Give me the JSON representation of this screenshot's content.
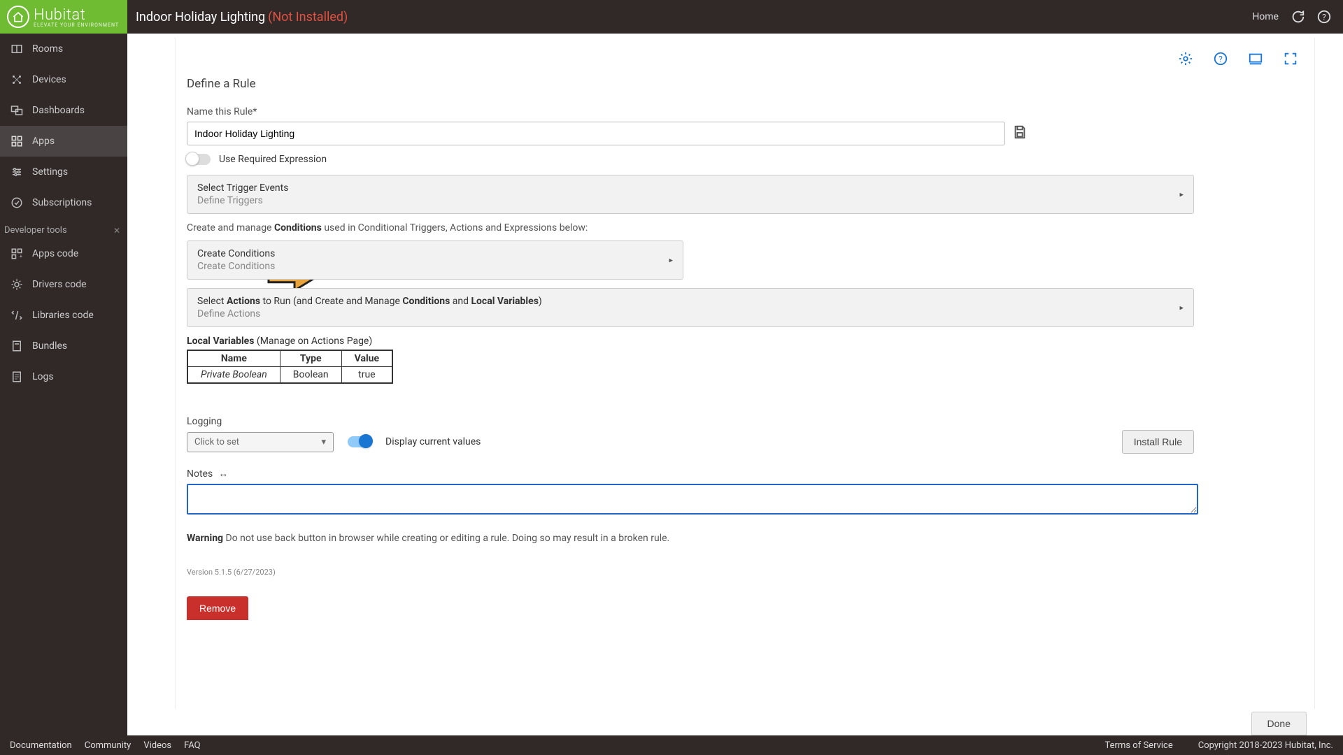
{
  "brand": {
    "name": "Hubitat",
    "tagline": "ELEVATE YOUR ENVIRONMENT"
  },
  "header": {
    "title": "Indoor Holiday Lighting",
    "status": "(Not Installed)",
    "home": "Home"
  },
  "sidebar": {
    "items": [
      {
        "id": "rooms",
        "label": "Rooms"
      },
      {
        "id": "devices",
        "label": "Devices"
      },
      {
        "id": "dashboards",
        "label": "Dashboards"
      },
      {
        "id": "apps",
        "label": "Apps",
        "active": true
      },
      {
        "id": "settings",
        "label": "Settings"
      },
      {
        "id": "subscriptions",
        "label": "Subscriptions"
      }
    ],
    "dev_section": "Developer tools",
    "dev_items": [
      {
        "id": "apps-code",
        "label": "Apps code"
      },
      {
        "id": "drivers-code",
        "label": "Drivers code"
      },
      {
        "id": "libraries-code",
        "label": "Libraries code"
      },
      {
        "id": "bundles",
        "label": "Bundles"
      },
      {
        "id": "logs",
        "label": "Logs"
      }
    ]
  },
  "page": {
    "section_title": "Define a Rule",
    "name_label": "Name this Rule*",
    "name_value": "Indoor Holiday Lighting",
    "use_required_expression": "Use Required Expression",
    "trigger_panel": {
      "title": "Select Trigger Events",
      "subtitle": "Define Triggers"
    },
    "conditions_intro_pre": "Create and manage ",
    "conditions_intro_bold": "Conditions",
    "conditions_intro_post": " used in Conditional Triggers, Actions and Expressions below:",
    "conditions_panel": {
      "title": "Create Conditions",
      "subtitle": "Create Conditions"
    },
    "actions_panel": {
      "pre": "Select ",
      "b1": "Actions",
      "mid1": " to Run (and Create and Manage ",
      "b2": "Conditions",
      "mid2": " and ",
      "b3": "Local Variables",
      "post": ")",
      "subtitle": "Define Actions"
    },
    "local_vars_title_bold": "Local Variables",
    "local_vars_title_rest": " (Manage on Actions Page)",
    "lv_headers": {
      "name": "Name",
      "type": "Type",
      "value": "Value"
    },
    "lv_row": {
      "name": "Private Boolean",
      "type": "Boolean",
      "value": "true"
    },
    "logging_label": "Logging",
    "logging_dropdown": "Click to set",
    "display_current": "Display current values",
    "install_rule": "Install Rule",
    "notes_label": "Notes",
    "warning_bold": "Warning",
    "warning_text": " Do not use back button in browser while creating or editing a rule. Doing so may result in a broken rule.",
    "version": "Version 5.1.5 (6/27/2023)",
    "remove": "Remove",
    "done": "Done"
  },
  "footer": {
    "links": [
      "Documentation",
      "Community",
      "Videos",
      "FAQ"
    ],
    "tos": "Terms of Service",
    "copyright": "Copyright 2018-2023 Hubitat, Inc."
  }
}
